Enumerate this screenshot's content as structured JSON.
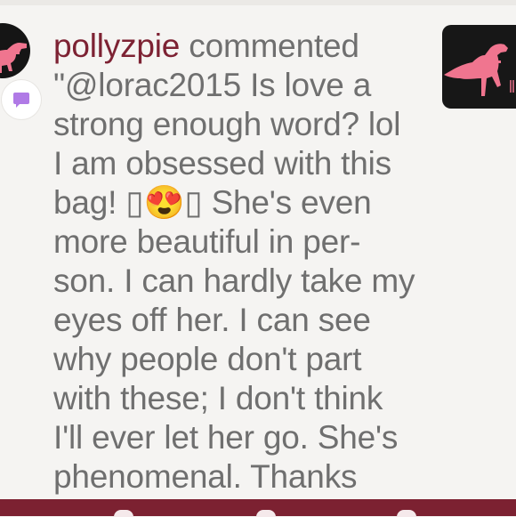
{
  "comment": {
    "username": "pollyzpie",
    "action": "commented",
    "lines": [
      "\"@lorac2015 Is love a",
      "strong enough word? lol",
      "I am obsessed with this",
      "bag! ▯😍▯ She's even",
      "more beautiful in per-",
      "son. I can hardly take my",
      "eyes off her. I can see",
      "why people don't part",
      "with these; I don't think",
      "I'll ever let her go. She's",
      "phenomenal. Thanks"
    ]
  },
  "icons": {
    "avatar": "pink-dinosaur-avatar",
    "badge": "comment-bubble-icon",
    "thumbnail": "pink-dinosaur-thumbnail"
  },
  "colors": {
    "accent": "#7c2131",
    "username": "#7d2233",
    "badge": "#b07ae6",
    "dinosaur": "#f0758f"
  }
}
